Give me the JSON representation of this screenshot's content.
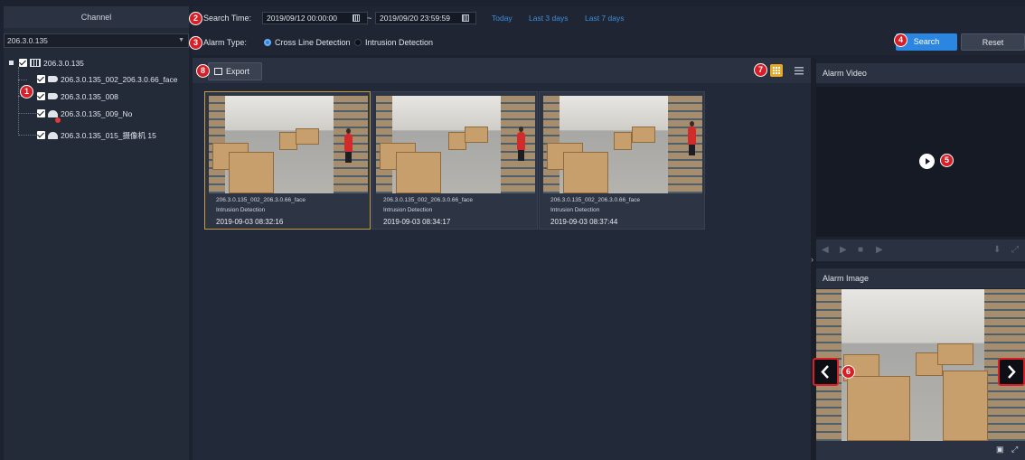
{
  "left": {
    "header": "Channel",
    "device_select": "206.3.0.135",
    "tree": {
      "root": "206.3.0.135",
      "items": [
        "206.3.0.135_002_206.3.0.66_face",
        "206.3.0.135_008",
        "206.3.0.135_009_No",
        "206.3.0.135_015_摄像机 15"
      ]
    }
  },
  "search": {
    "time_label": "Search Time:",
    "start": "2019/09/12 00:00:00",
    "separator": "~",
    "end": "2019/09/20 23:59:59",
    "quick": [
      "Today",
      "Last 3 days",
      "Last 7 days"
    ],
    "type_label": "Alarm Type:",
    "types": [
      "Cross Line Detection",
      "Intrusion Detection"
    ],
    "search_btn": "Search",
    "reset_btn": "Reset"
  },
  "results": {
    "export_btn": "Export",
    "thumbs": [
      {
        "channel": "206.3.0.135_002_206.3.0.66_face",
        "type": "Intrusion Detection",
        "time": "2019-09-03 08:32:16"
      },
      {
        "channel": "206.3.0.135_002_206.3.0.66_face",
        "type": "Intrusion Detection",
        "time": "2019-09-03 08:34:17"
      },
      {
        "channel": "206.3.0.135_002_206.3.0.66_face",
        "type": "Intrusion Detection",
        "time": "2019-09-03 08:37:44"
      }
    ]
  },
  "right": {
    "video_title": "Alarm Video",
    "image_title": "Alarm Image"
  },
  "callouts": [
    "1",
    "2",
    "3",
    "4",
    "5",
    "6",
    "7",
    "8"
  ],
  "colors": {
    "accent": "#2a86e0",
    "callout": "#d61f26",
    "selected_border": "#c79a3d",
    "grid_view_active": "#e8a928"
  }
}
